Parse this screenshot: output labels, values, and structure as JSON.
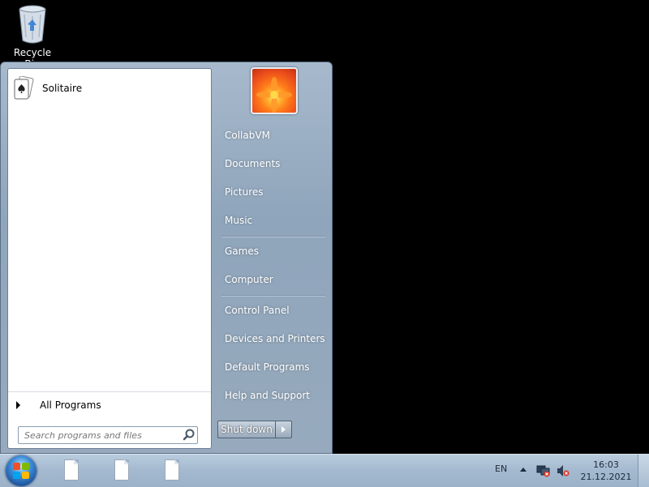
{
  "desktop": {
    "icons": [
      {
        "label": "Recycle Bin",
        "icon": "recycle-bin-icon"
      }
    ]
  },
  "start_menu": {
    "pinned_programs": [
      {
        "label": "Solitaire",
        "icon": "solitaire-icon"
      }
    ],
    "all_programs_label": "All Programs",
    "search": {
      "placeholder": "Search programs and files",
      "value": ""
    },
    "user_picture": "flower-user-picture",
    "right_items": [
      {
        "label": "CollabVM"
      },
      {
        "label": "Documents"
      },
      {
        "label": "Pictures"
      },
      {
        "label": "Music"
      },
      {
        "label": "Games"
      },
      {
        "label": "Computer"
      },
      {
        "label": "Control Panel"
      },
      {
        "label": "Devices and Printers"
      },
      {
        "label": "Default Programs"
      },
      {
        "label": "Help and Support"
      }
    ],
    "shutdown_label": "Shut down"
  },
  "taskbar": {
    "start_button": "windows-start-orb",
    "task_buttons": [
      {
        "icon": "document-icon"
      },
      {
        "icon": "document-icon"
      },
      {
        "icon": "document-icon"
      }
    ],
    "tray": {
      "language": "EN",
      "clock_time": "16:03",
      "clock_date": "21.12.2021"
    }
  },
  "colors": {
    "taskbar": "#a3b9cf",
    "start_menu_right": "#8fa5bb",
    "desktop": "#000000"
  }
}
